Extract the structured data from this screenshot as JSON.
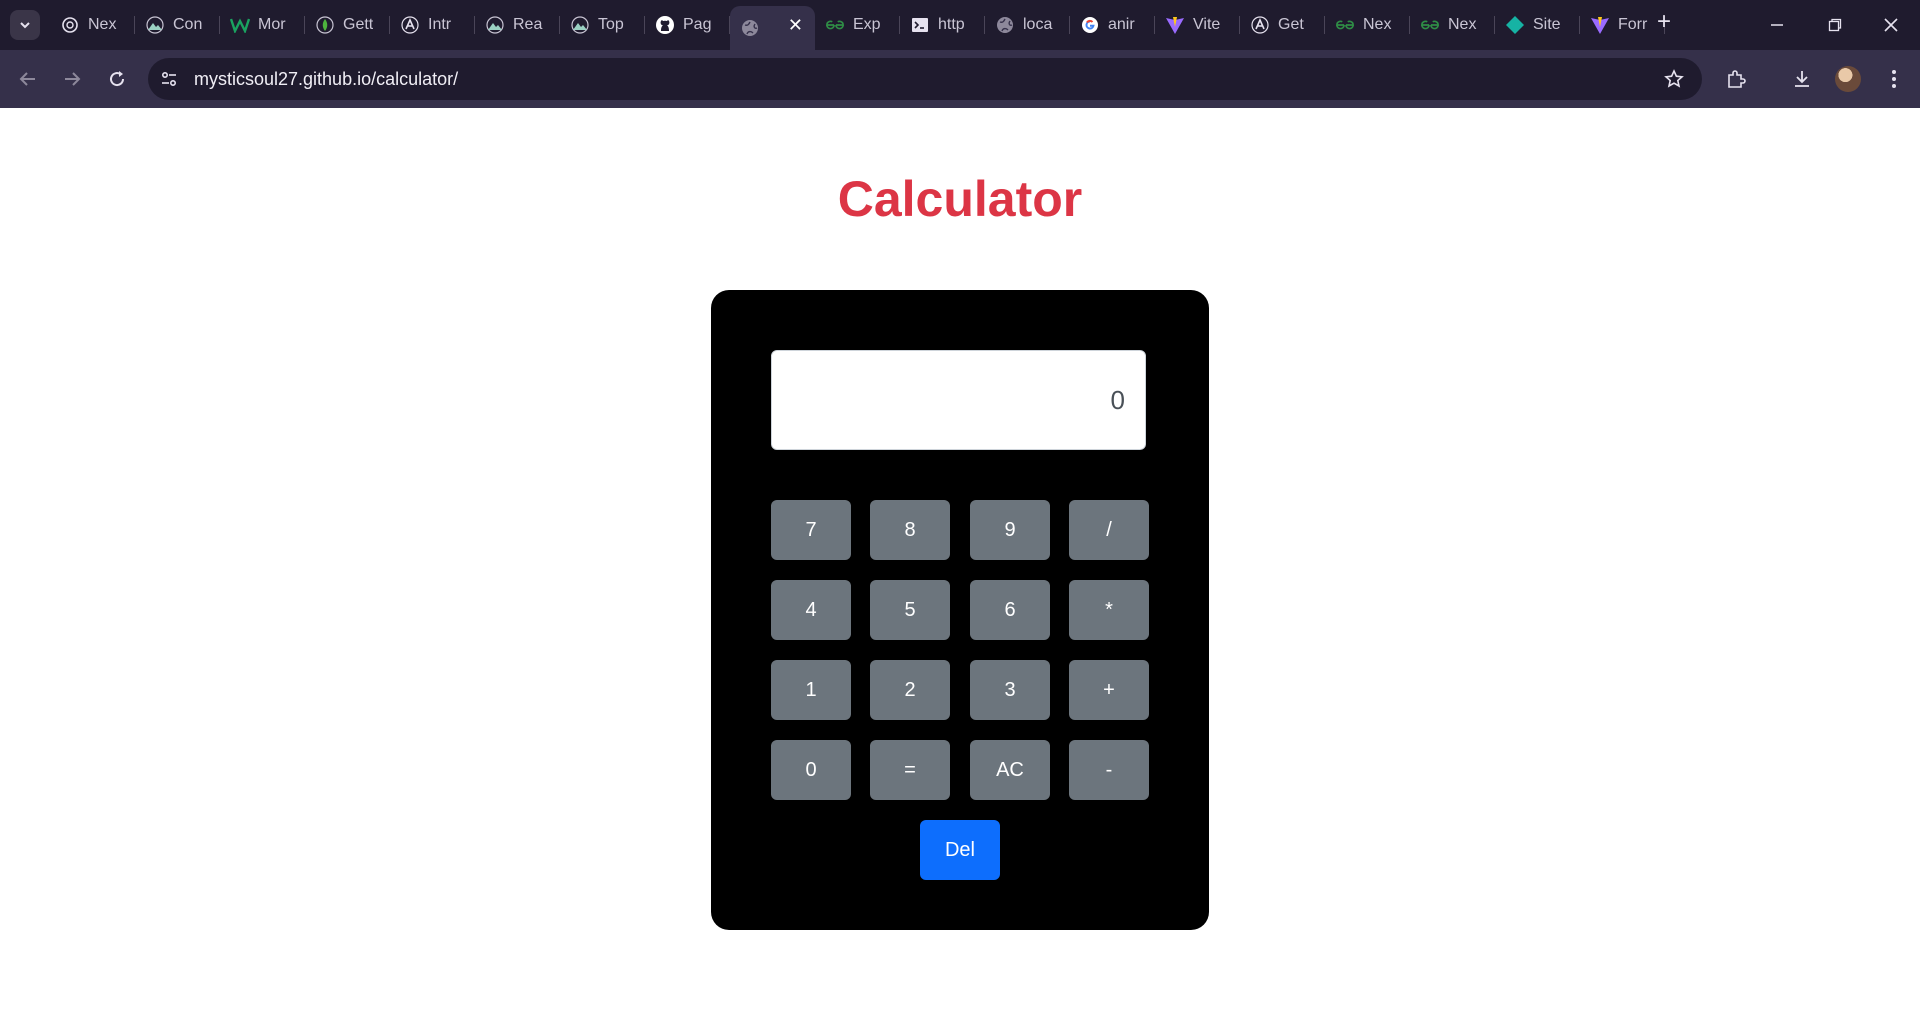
{
  "browser": {
    "tabs": [
      {
        "title": "Nex",
        "icon": "openai-icon"
      },
      {
        "title": "Con",
        "icon": "mountain-icon"
      },
      {
        "title": "Mor",
        "icon": "w-icon"
      },
      {
        "title": "Gett",
        "icon": "mongodb-icon"
      },
      {
        "title": "Intr",
        "icon": "a-icon"
      },
      {
        "title": "Rea",
        "icon": "mountain-icon"
      },
      {
        "title": "Top",
        "icon": "mountain-icon"
      },
      {
        "title": "Pag",
        "icon": "github-icon"
      },
      {
        "title": "",
        "icon": "globe-icon",
        "active": true
      },
      {
        "title": "Exp",
        "icon": "gfg-icon"
      },
      {
        "title": "http",
        "icon": "terminal-icon"
      },
      {
        "title": "loca",
        "icon": "globe-icon"
      },
      {
        "title": "anir",
        "icon": "google-icon"
      },
      {
        "title": "Vite",
        "icon": "vite-icon"
      },
      {
        "title": "Get",
        "icon": "a-icon"
      },
      {
        "title": "Nex",
        "icon": "gfg-icon"
      },
      {
        "title": "Nex",
        "icon": "gfg-icon"
      },
      {
        "title": "Site",
        "icon": "diamond-icon"
      },
      {
        "title": "Forr",
        "icon": "vite-icon"
      }
    ],
    "url": "mysticsoul27.github.io/calculator/"
  },
  "page": {
    "title": "Calculator",
    "display_value": "0"
  },
  "keys": {
    "k7": "7",
    "k8": "8",
    "k9": "9",
    "div": "/",
    "k4": "4",
    "k5": "5",
    "k6": "6",
    "mul": "*",
    "k1": "1",
    "k2": "2",
    "k3": "3",
    "add": "+",
    "k0": "0",
    "eq": "=",
    "ac": "AC",
    "sub": "-",
    "del": "Del"
  },
  "colors": {
    "title": "#dc3545",
    "key": "#6c757d",
    "del_key": "#0d6efd",
    "calculator_bg": "#000000"
  }
}
